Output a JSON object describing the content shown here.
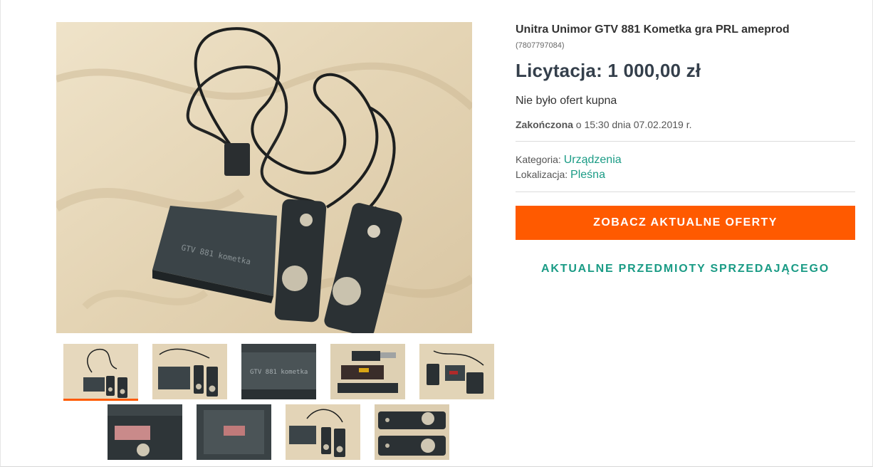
{
  "product": {
    "title": "Unitra Unimor GTV 881 Kometka gra PRL ameprod",
    "id": "(7807797084)",
    "price": "Licytacja: 1 000,00 zł",
    "offers_status": "Nie było ofert kupna",
    "ended_label": "Zakończona",
    "ended_text": " o 15:30 dnia 07.02.2019 r.",
    "category_label": "Kategoria: ",
    "category_value": "Urządzenia",
    "location_label": "Lokalizacja: ",
    "location_value": "Pleśna"
  },
  "actions": {
    "see_offers": "ZOBACZ AKTUALNE OFERTY",
    "seller_items": "AKTUALNE PRZEDMIOTY SPRZEDAJĄCEGO"
  },
  "colors": {
    "accent": "#ff5a00",
    "link": "#1a9b85",
    "price": "#343f4b"
  },
  "gallery": {
    "thumbnail_count": 9,
    "selected_index": 0
  }
}
